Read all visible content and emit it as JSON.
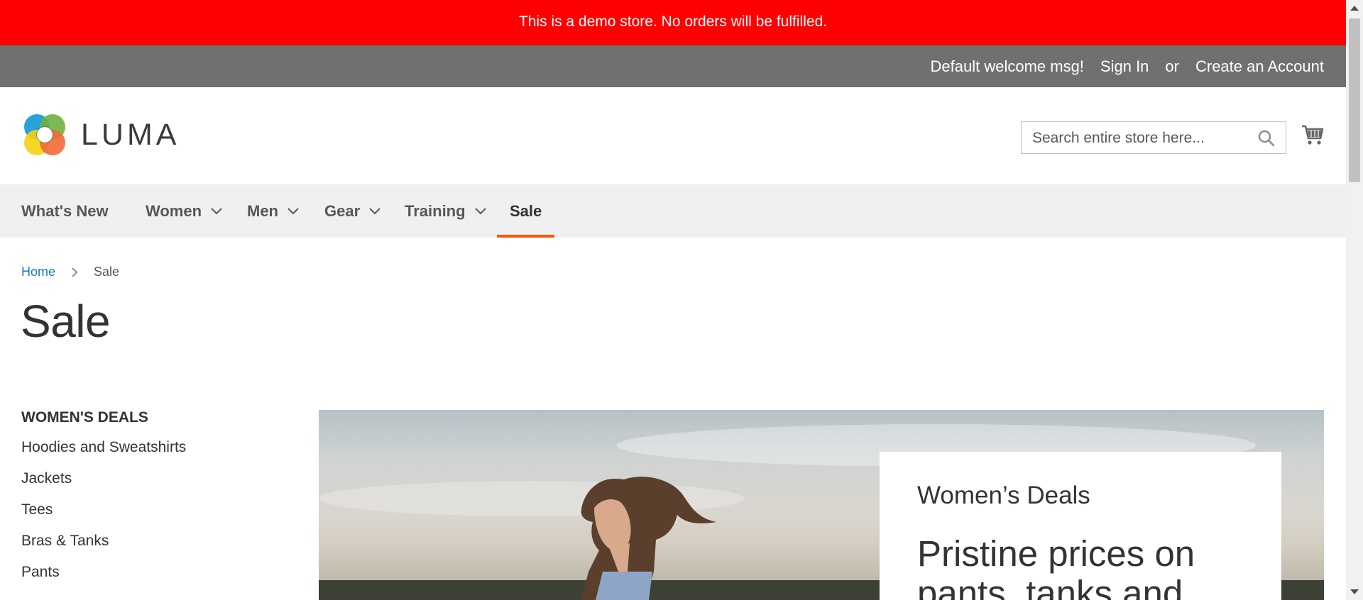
{
  "demo_notice": "This is a demo store. No orders will be fulfilled.",
  "top_bar": {
    "welcome": "Default welcome msg!",
    "sign_in": "Sign In",
    "or": "or",
    "create_account": "Create an Account"
  },
  "logo": {
    "text": "LUMA"
  },
  "search": {
    "placeholder": "Search entire store here...",
    "icon": "search-icon"
  },
  "cart": {
    "icon": "cart-icon"
  },
  "nav": {
    "items": [
      {
        "label": "What's New",
        "has_dropdown": false
      },
      {
        "label": "Women",
        "has_dropdown": true
      },
      {
        "label": "Men",
        "has_dropdown": true
      },
      {
        "label": "Gear",
        "has_dropdown": true
      },
      {
        "label": "Training",
        "has_dropdown": true
      },
      {
        "label": "Sale",
        "has_dropdown": false,
        "active": true
      }
    ]
  },
  "breadcrumb": {
    "home": "Home",
    "current": "Sale"
  },
  "page_title": "Sale",
  "sidebar": {
    "heading": "WOMEN'S DEALS",
    "items": [
      "Hoodies and Sweatshirts",
      "Jackets",
      "Tees",
      "Bras & Tanks",
      "Pants"
    ]
  },
  "promo": {
    "kicker": "Women’s Deals",
    "headline": "Pristine prices on pants, tanks and"
  },
  "colors": {
    "demo_bar": "#ff0000",
    "top_bar": "#6e716e",
    "nav_bg": "#f0f0f0",
    "nav_active_underline": "#ff5501",
    "link": "#1979c3"
  }
}
